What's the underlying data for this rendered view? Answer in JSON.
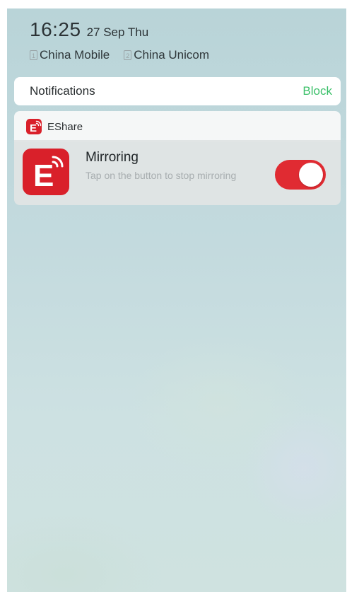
{
  "status": {
    "time": "16:25",
    "date": "27 Sep Thu",
    "carriers": [
      {
        "sim": "1",
        "name": "China Mobile"
      },
      {
        "sim": "2",
        "name": "China Unicom"
      }
    ]
  },
  "notifications": {
    "title": "Notifications",
    "block_label": "Block",
    "block_color": "#3cc06a"
  },
  "app": {
    "name": "EShare",
    "icon": "eshare-logo-icon",
    "brand_color": "#d9202a",
    "notification": {
      "title": "Mirroring",
      "subtitle": "Tap on the button to stop mirroring",
      "toggle_on": true
    }
  }
}
